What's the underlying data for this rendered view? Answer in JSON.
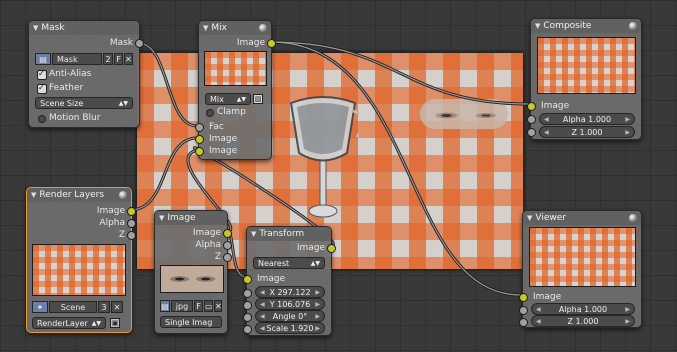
{
  "colors": {
    "grid_bg": "#393939",
    "node_bg": "#6e6e6e",
    "socket_image": "#c7c729",
    "socket_value": "#a1a1a1",
    "active_border": "#e89a2a"
  },
  "mask": {
    "title": "Mask",
    "out_mask": "Mask",
    "mask_name": "Mask",
    "user_count": "2",
    "fake_user": "F",
    "anti_alias": "Anti-Alias",
    "feather": "Feather",
    "size_mode": "Scene Size",
    "motion_blur": "Motion Blur"
  },
  "mix": {
    "title": "Mix",
    "out_image": "Image",
    "blend_mode": "Mix",
    "clamp": "Clamp",
    "in_fac": "Fac",
    "in_image1": "Image",
    "in_image2": "Image"
  },
  "composite": {
    "title": "Composite",
    "in_image": "Image",
    "alpha": "Alpha 1.000",
    "z": "Z 1.000"
  },
  "render_layers": {
    "title": "Render Layers",
    "out_image": "Image",
    "out_alpha": "Alpha",
    "out_z": "Z",
    "scene": "Scene",
    "scene_users": "3",
    "layer": "RenderLayer"
  },
  "image_node": {
    "title": "Image",
    "out_image": "Image",
    "out_alpha": "Alpha",
    "out_z": "Z",
    "image_name": "jpg",
    "fake_user": "F",
    "source": "Single Imag"
  },
  "transform": {
    "title": "Transform",
    "out_image": "Image",
    "filter": "Nearest",
    "in_image": "Image",
    "x": "X 297.122",
    "y": "Y 106.076",
    "angle": "Angle 0°",
    "scale": "Scale 1.920"
  },
  "viewer": {
    "title": "Viewer",
    "in_image": "Image",
    "alpha": "Alpha 1.000",
    "z": "Z 1.000"
  }
}
